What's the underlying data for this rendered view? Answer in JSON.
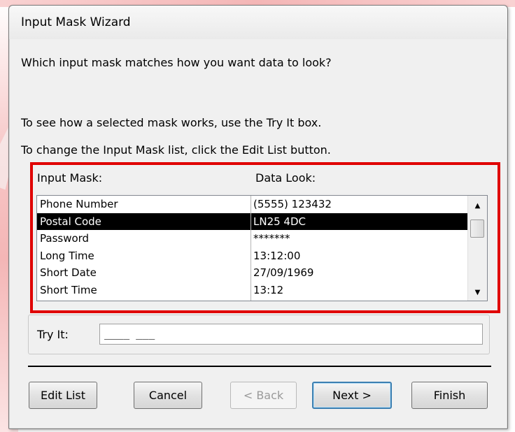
{
  "window": {
    "title": "Input Mask Wizard"
  },
  "instructions": {
    "question": "Which input mask matches how you want data to look?",
    "hint_try": "To see how a selected mask works, use the Try It box.",
    "hint_edit": "To change the Input Mask list, click the Edit List button."
  },
  "list": {
    "header_mask": "Input Mask:",
    "header_look": "Data Look:",
    "rows": [
      {
        "mask": "Phone Number",
        "look": "(5555) 123432"
      },
      {
        "mask": "Postal Code",
        "look": "LN25 4DC"
      },
      {
        "mask": "Password",
        "look": "*******"
      },
      {
        "mask": "Long Time",
        "look": "13:12:00"
      },
      {
        "mask": "Short Date",
        "look": "27/09/1969"
      },
      {
        "mask": "Short Time",
        "look": "13:12"
      }
    ],
    "selected_index": 1
  },
  "tryit": {
    "label": "Try It:",
    "value": "____ ___"
  },
  "buttons": {
    "edit_list": "Edit List",
    "cancel": "Cancel",
    "back": "< Back",
    "next": "Next >",
    "finish": "Finish"
  },
  "colors": {
    "highlight_border": "#e00000",
    "selected_row_bg": "#000000",
    "selected_row_fg": "#ffffff"
  },
  "icons": {
    "scroll_up": "triangle-up",
    "scroll_down": "triangle-down"
  }
}
